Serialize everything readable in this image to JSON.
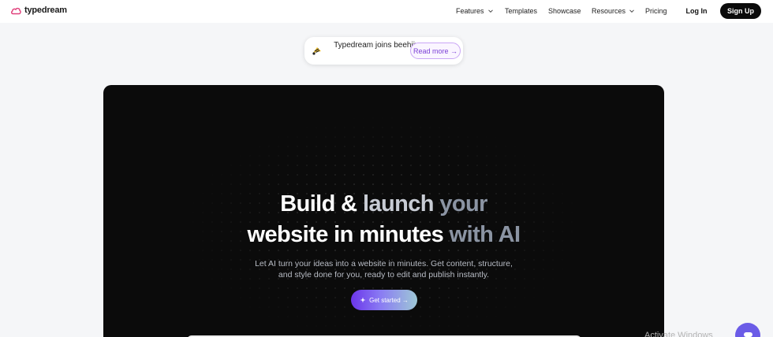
{
  "nav": {
    "logo_text": "typedream",
    "items": [
      {
        "label": "Features",
        "has_dropdown": true
      },
      {
        "label": "Templates",
        "has_dropdown": false
      },
      {
        "label": "Showcase",
        "has_dropdown": false
      },
      {
        "label": "Resources",
        "has_dropdown": true
      },
      {
        "label": "Pricing",
        "has_dropdown": false
      }
    ],
    "login_label": "Log In",
    "signup_label": "Sign Up"
  },
  "banner": {
    "text": "Typedream joins beehiiv",
    "read_more_label": "Read more →"
  },
  "hero": {
    "title_part1": "Build & ",
    "title_part2": "launch ",
    "title_part3": "your",
    "title_line2_part1": "website in minutes ",
    "title_line2_part2": "with AI",
    "subtitle": "Let AI turn your ideas into a website in minutes. Get content, structure, and style done for you, ready to edit and publish instantly.",
    "cta_label": "Get started →"
  },
  "overlay": {
    "watermark": "Activate Windows"
  },
  "colors": {
    "brand_accent": "#7b3fd6",
    "hero_bg": "#0b0b0b",
    "cta_gradient_start": "#6b35ea",
    "cta_gradient_end": "#9ec8d6",
    "chat_bubble": "#6b5ce7"
  },
  "icons": {
    "logo": "cloud-logo-icon",
    "banner": "bee-icon",
    "dropdown": "chevron-down-icon",
    "cta": "sparkle-icon",
    "chat": "chat-icon"
  }
}
